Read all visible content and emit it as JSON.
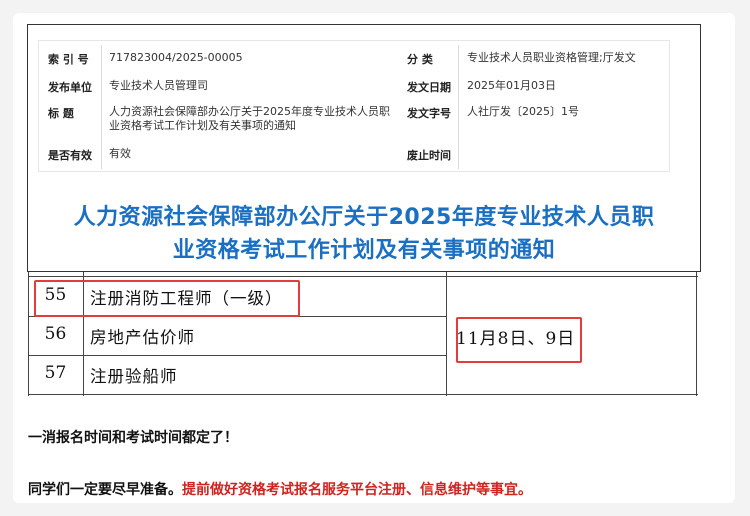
{
  "meta": {
    "index_label": "索 引 号",
    "index_value": "717823004/2025-00005",
    "category_label": "分 类",
    "category_value": "专业技术人员职业资格管理;厅发文",
    "issuer_label": "发布单位",
    "issuer_value": "专业技术人员管理司",
    "date_label": "发文日期",
    "date_value": "2025年01月03日",
    "title_label": "标 题",
    "title_value": "人力资源社会保障部办公厅关于2025年度专业技术人员职业资格考试工作计划及有关事项的通知",
    "docno_label": "发文字号",
    "docno_value": "人社厅发〔2025〕1号",
    "valid_label": "是否有效",
    "valid_value": "有效",
    "repeal_label": "废止时间",
    "repeal_value": ""
  },
  "headline": {
    "line1": "人力资源社会保障部办公厅关于2025年度专业技术人员职",
    "line2": "业资格考试工作计划及有关事项的通知"
  },
  "table": {
    "rows": [
      {
        "no": "55",
        "name": "注册消防工程师（一级）"
      },
      {
        "no": "56",
        "name": "房地产估价师"
      },
      {
        "no": "57",
        "name": "注册验船师"
      }
    ],
    "merged_date": "11月8日、9日"
  },
  "body": {
    "line1": "一消报名时间和考试时间都定了！",
    "line2_black": "同学们一定要尽早准备。",
    "line2_red": "提前做好资格考试报名服务平台注册、信息维护等事宜。"
  },
  "colors": {
    "headline": "#1a6fc2",
    "highlight_box": "#e23c3c",
    "emphasis_text": "#d0231f"
  }
}
